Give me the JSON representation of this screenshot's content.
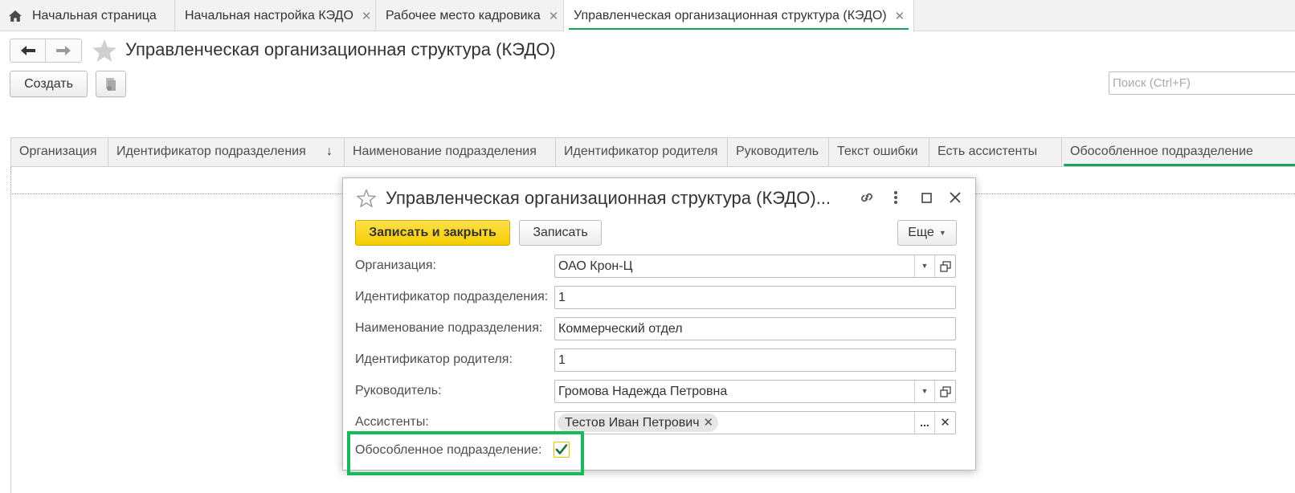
{
  "tabs": [
    {
      "label": "Начальная страница",
      "icon": "home-icon"
    },
    {
      "label": "Начальная настройка КЭДО",
      "closable": true
    },
    {
      "label": "Рабочее место кадровика",
      "closable": true
    },
    {
      "label": "Управленческая организационная структура (КЭДО)",
      "closable": true,
      "active": true
    }
  ],
  "page": {
    "title": "Управленческая организационная структура (КЭДО)",
    "create_label": "Создать",
    "search_placeholder": "Поиск (Ctrl+F)"
  },
  "table": {
    "columns": [
      "Организация",
      "Идентификатор подразделения",
      "Наименование подразделения",
      "Идентификатор родителя",
      "Руководитель",
      "Текст ошибки",
      "Есть ассистенты",
      "Обособленное подразделение"
    ],
    "sort_indicator": "↓",
    "rows": []
  },
  "modal": {
    "title": "Управленческая организационная структура (КЭДО)...",
    "save_close_label": "Записать и закрыть",
    "save_label": "Записать",
    "more_label": "Еще",
    "fields": {
      "organization_label": "Организация:",
      "organization_value": "ОАО Крон-Ц",
      "dept_id_label": "Идентификатор подразделения:",
      "dept_id_value": "1",
      "dept_name_label": "Наименование подразделения:",
      "dept_name_value": "Коммерческий отдел",
      "parent_id_label": "Идентификатор родителя:",
      "parent_id_value": "1",
      "head_label": "Руководитель:",
      "head_value": "Громова Надежда Петровна",
      "assistants_label": "Ассистенты:",
      "assistants": [
        "Тестов Иван Петрович"
      ],
      "separate_label": "Обособленное подразделение:",
      "separate_checked": true
    }
  },
  "colors": {
    "accent_green": "#1aa35a",
    "highlight_green": "#1ab85a",
    "primary_button": "#f5cc00"
  }
}
